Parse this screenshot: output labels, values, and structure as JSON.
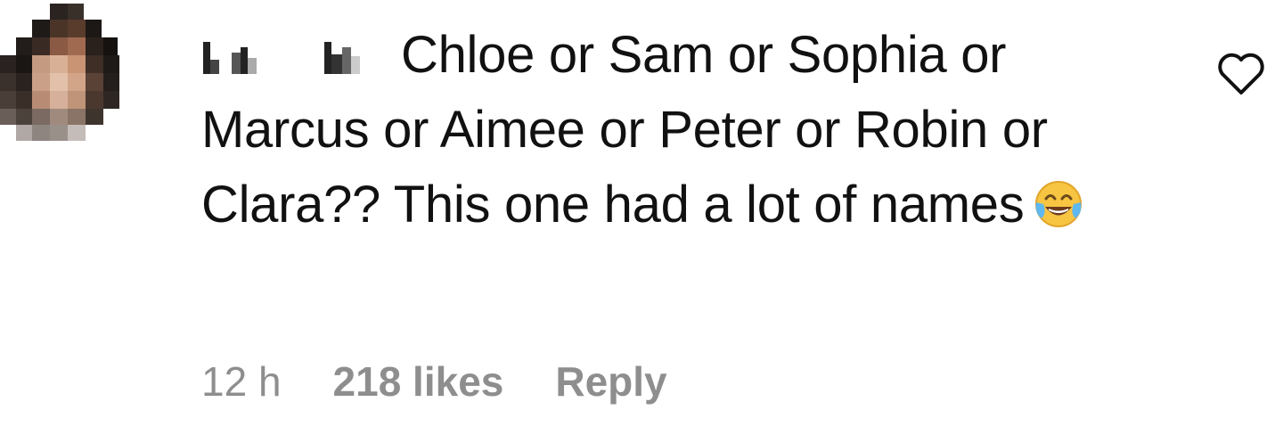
{
  "comment": {
    "text": "Chloe or Sam or Sophia or Marcus or Aimee or Peter or Robin or Clara?? This one had a lot of names",
    "emoji": "face-with-tears-of-joy",
    "time": "12 h",
    "likes": "218 likes",
    "reply_label": "Reply",
    "like_icon": "heart-outline-icon"
  },
  "colors": {
    "meta_text": "#8e8e8e",
    "body_text": "#111111",
    "emoji_yellow": "#f7c542",
    "emoji_tears": "#5fb8ee"
  }
}
